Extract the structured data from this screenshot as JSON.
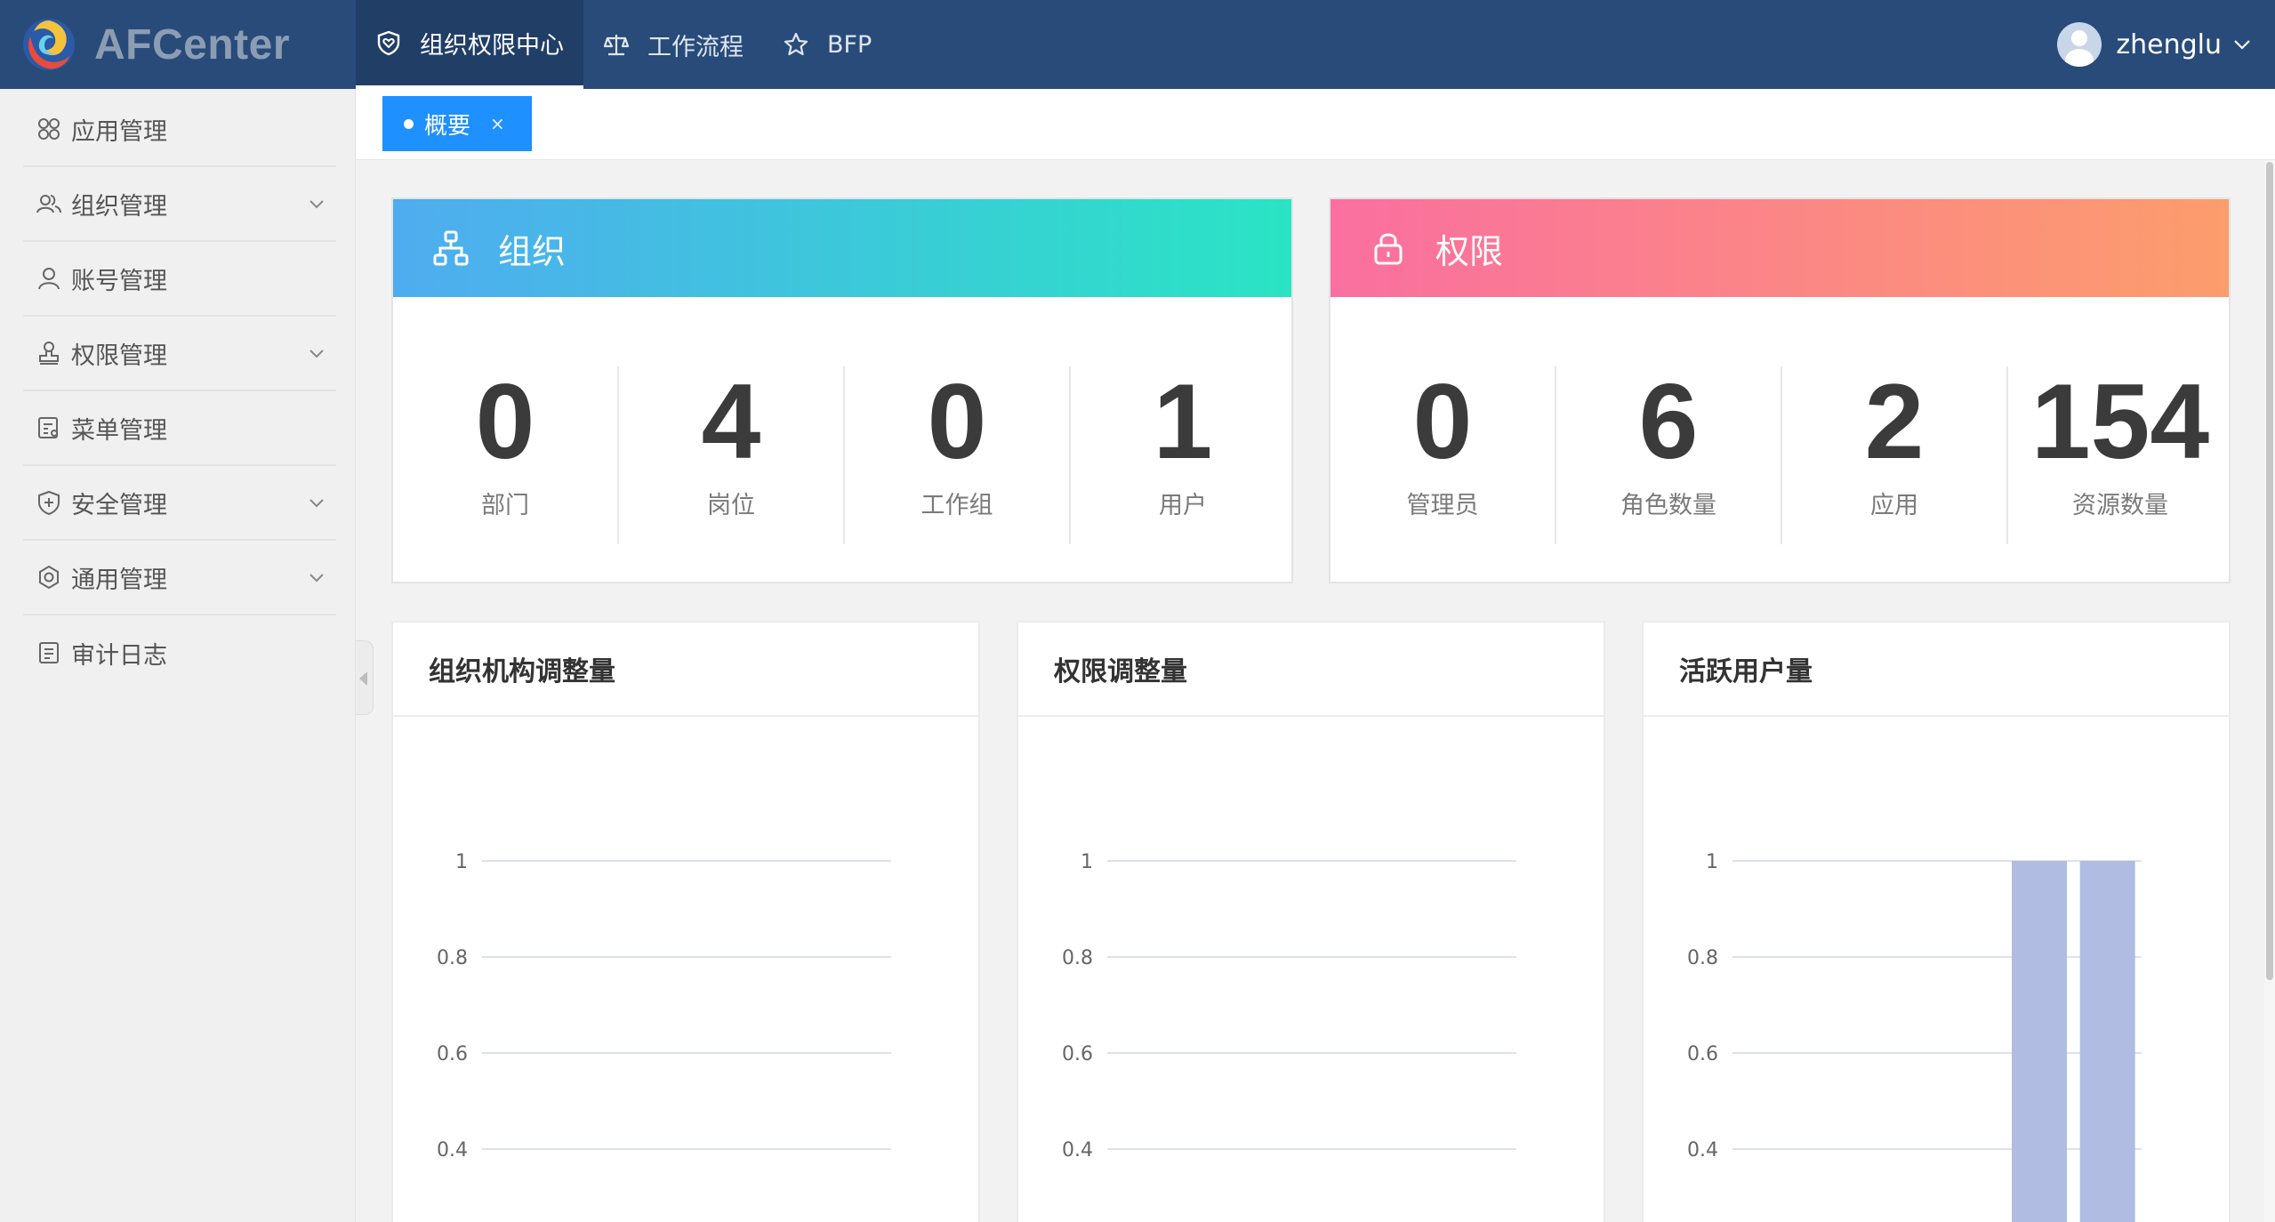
{
  "header": {
    "app_name": "AFCenter",
    "nav": [
      {
        "label": "组织权限中心",
        "icon": "shield-heart-icon",
        "active": true
      },
      {
        "label": "工作流程",
        "icon": "scale-icon",
        "active": false
      },
      {
        "label": "BFP",
        "icon": "star-icon",
        "active": false
      }
    ],
    "user": {
      "name": "zhenglu"
    }
  },
  "sidebar": {
    "items": [
      {
        "label": "应用管理",
        "icon": "apps-grid-icon",
        "has_children": false
      },
      {
        "label": "组织管理",
        "icon": "users-icon",
        "has_children": true
      },
      {
        "label": "账号管理",
        "icon": "user-icon",
        "has_children": false
      },
      {
        "label": "权限管理",
        "icon": "stamp-icon",
        "has_children": true
      },
      {
        "label": "菜单管理",
        "icon": "menu-doc-icon",
        "has_children": false
      },
      {
        "label": "安全管理",
        "icon": "shield-plus-icon",
        "has_children": true
      },
      {
        "label": "通用管理",
        "icon": "gear-icon",
        "has_children": true
      },
      {
        "label": "审计日志",
        "icon": "log-doc-icon",
        "has_children": false
      }
    ]
  },
  "tabs": [
    {
      "label": "概要",
      "close": "×",
      "active": true
    }
  ],
  "stats": {
    "org": {
      "title": "组织",
      "icon": "org-tree-icon",
      "gradient": [
        "#4facf0",
        "#2ae4c4"
      ],
      "items": [
        {
          "value": "0",
          "label": "部门"
        },
        {
          "value": "4",
          "label": "岗位"
        },
        {
          "value": "0",
          "label": "工作组"
        },
        {
          "value": "1",
          "label": "用户"
        }
      ]
    },
    "perm": {
      "title": "权限",
      "icon": "lock-icon",
      "gradient": [
        "#fa6fa0",
        "#fc9d6c"
      ],
      "items": [
        {
          "value": "0",
          "label": "管理员"
        },
        {
          "value": "6",
          "label": "角色数量"
        },
        {
          "value": "2",
          "label": "应用"
        },
        {
          "value": "154",
          "label": "资源数量"
        }
      ]
    }
  },
  "colors": {
    "header_bg": "#284b7a",
    "tab_active": "#1e90ff",
    "bar": "#b0bce2",
    "grid": "#dde1ef"
  },
  "chart_data": [
    {
      "type": "bar",
      "title": "组织机构调整量",
      "yticks": [
        1,
        0.8,
        0.6,
        0.4
      ],
      "values": [],
      "ylim": [
        0,
        1
      ]
    },
    {
      "type": "bar",
      "title": "权限调整量",
      "yticks": [
        1,
        0.8,
        0.6,
        0.4
      ],
      "values": [],
      "ylim": [
        0,
        1
      ]
    },
    {
      "type": "bar",
      "title": "活跃用户量",
      "yticks": [
        1,
        0.8,
        0.6,
        0.4
      ],
      "values": [
        0,
        0,
        0,
        0,
        1,
        1
      ],
      "ylim": [
        0,
        1
      ]
    }
  ]
}
